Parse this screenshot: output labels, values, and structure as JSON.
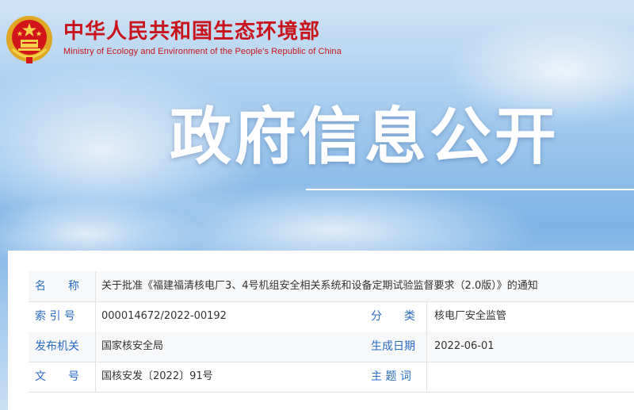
{
  "header": {
    "ministry_cn": "中华人民共和国生态环境部",
    "ministry_en": "Ministry of Ecology and Environment of the People's Republic of China"
  },
  "banner": {
    "title": "政府信息公开"
  },
  "info": {
    "name_label": "名　　称",
    "name_value": "关于批准《福建福清核电厂3、4号机组安全相关系统和设备定期试验监督要求（2.0版）》的通知",
    "index_label": "索 引 号",
    "index_value": "000014672/2022-00192",
    "category_label": "分　　类",
    "category_value": "核电厂安全监管",
    "issuer_label": "发布机关",
    "issuer_value": "国家核安全局",
    "date_label": "生成日期",
    "date_value": "2022-06-01",
    "doc_no_label": "文　　号",
    "doc_no_value": "国核安发〔2022〕91号",
    "subject_label": "主 题 词",
    "subject_value": ""
  },
  "colors": {
    "ministry_red": "#c9141b",
    "label_blue": "#2a6cc4",
    "banner_sky": "#7fb4e6"
  }
}
